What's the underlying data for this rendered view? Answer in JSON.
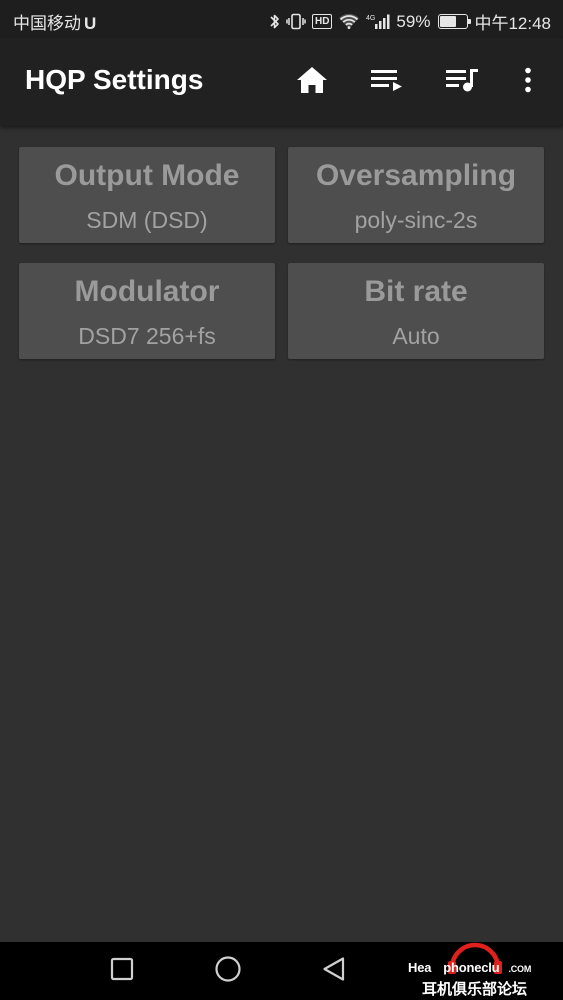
{
  "status_bar": {
    "carrier": "中国移动",
    "carrier_icon": "U",
    "network": "4G",
    "battery_percent": "59%",
    "battery_level": 0.59,
    "time": "中午12:48",
    "icons": [
      "bluetooth-icon",
      "vibrate-icon",
      "hd-icon",
      "wifi-icon",
      "signal-icon",
      "battery-icon"
    ]
  },
  "toolbar": {
    "title": "HQP Settings",
    "icons": [
      "home-icon",
      "queue-icon",
      "playlist-icon",
      "more-vert-icon"
    ]
  },
  "settings": [
    {
      "title": "Output Mode",
      "value": "SDM (DSD)"
    },
    {
      "title": "Oversampling",
      "value": "poly-sinc-2s"
    },
    {
      "title": "Modulator",
      "value": "DSD7 256+fs"
    },
    {
      "title": "Bit rate",
      "value": "Auto"
    }
  ],
  "nav_bar": {
    "icons": [
      "recents-square-icon",
      "home-circle-icon",
      "back-triangle-icon"
    ]
  },
  "watermark": {
    "line1_prefix": "Hea",
    "line1_middle": "phoneclu",
    "line1_suffix": ".COM",
    "line2": "耳机俱乐部论坛"
  },
  "colors": {
    "background": "#303030",
    "toolbar": "#212121",
    "tile": "#4e4e4e",
    "tile_text": "#9a9a9a",
    "watermark_accent": "#e0201c"
  }
}
